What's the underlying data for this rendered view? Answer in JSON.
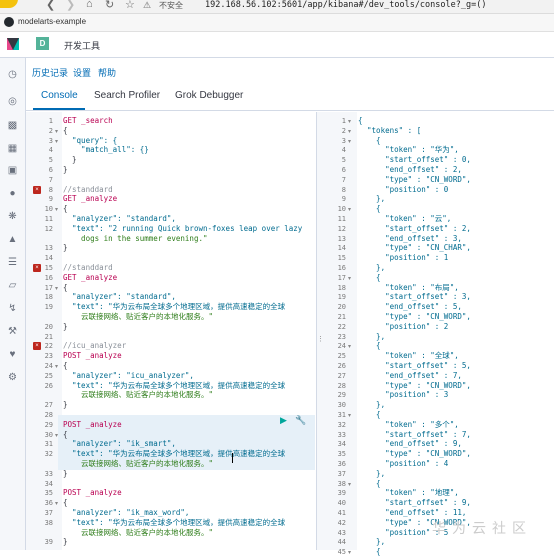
{
  "browser": {
    "security_label": "不安全",
    "url": "192.168.56.102:5601/app/kibana#/dev_tools/console?_g=()",
    "bookmark": "modelarts-example"
  },
  "kibana": {
    "app_title": "开发工具",
    "menu": [
      "历史记录",
      "设置",
      "帮助"
    ],
    "tabs": [
      "Console",
      "Search Profiler",
      "Grok Debugger"
    ],
    "active_tab": "Console"
  },
  "watermark": "华为云社区",
  "editor": {
    "lines": [
      {
        "n": "1",
        "t": "GET _search",
        "c": "kw"
      },
      {
        "n": "2",
        "t": "{",
        "c": "pun",
        "fold": true
      },
      {
        "n": "3",
        "t": "  \"query\": {",
        "c": "key",
        "fold": true
      },
      {
        "n": "4",
        "t": "    \"match_all\": {}",
        "c": "key"
      },
      {
        "n": "5",
        "t": "  }",
        "c": "pun"
      },
      {
        "n": "6",
        "t": "}",
        "c": "pun"
      },
      {
        "n": "7",
        "t": "",
        "c": "pun"
      },
      {
        "n": "8",
        "t": "//standdard",
        "c": "cmt",
        "err": true
      },
      {
        "n": "9",
        "t": "GET _analyze",
        "c": "kw"
      },
      {
        "n": "10",
        "t": "{",
        "c": "pun",
        "fold": true
      },
      {
        "n": "11",
        "t": "  \"analyzer\": \"standard\",",
        "c": "mix"
      },
      {
        "n": "12",
        "t": "  \"text\": \"2 running Quick brown-foxes leap over lazy",
        "c": "mix"
      },
      {
        "n": "",
        "t": "    dogs in the summer evening.\"",
        "c": "str"
      },
      {
        "n": "13",
        "t": "}",
        "c": "pun"
      },
      {
        "n": "14",
        "t": "",
        "c": "pun"
      },
      {
        "n": "15",
        "t": "//standdard",
        "c": "cmt",
        "err": true
      },
      {
        "n": "16",
        "t": "GET _analyze",
        "c": "kw"
      },
      {
        "n": "17",
        "t": "{",
        "c": "pun",
        "fold": true
      },
      {
        "n": "18",
        "t": "  \"analyzer\": \"standard\",",
        "c": "mix"
      },
      {
        "n": "19",
        "t": "  \"text\": \"华为云布局全球多个地理区域，提供高速稳定的全球",
        "c": "mix"
      },
      {
        "n": "",
        "t": "    云联接网络、贴近客户的本地化服务。\"",
        "c": "str"
      },
      {
        "n": "20",
        "t": "}",
        "c": "pun"
      },
      {
        "n": "21",
        "t": "",
        "c": "pun"
      },
      {
        "n": "22",
        "t": "//icu_analyzer",
        "c": "cmt",
        "err": true
      },
      {
        "n": "23",
        "t": "POST _analyze",
        "c": "kw"
      },
      {
        "n": "24",
        "t": "{",
        "c": "pun",
        "fold": true
      },
      {
        "n": "25",
        "t": "  \"analyzer\": \"icu_analyzer\",",
        "c": "mix"
      },
      {
        "n": "26",
        "t": "  \"text\": \"华为云布局全球多个地理区域，提供高速稳定的全球",
        "c": "mix"
      },
      {
        "n": "",
        "t": "    云联接网络、贴近客户的本地化服务。\"",
        "c": "str"
      },
      {
        "n": "27",
        "t": "}",
        "c": "pun"
      },
      {
        "n": "28",
        "t": "",
        "c": "pun"
      },
      {
        "n": "29",
        "t": "POST _analyze",
        "c": "kw",
        "sel": true
      },
      {
        "n": "30",
        "t": "{",
        "c": "pun",
        "fold": true,
        "sel": true
      },
      {
        "n": "31",
        "t": "  \"analyzer\": \"ik_smart\",",
        "c": "mix",
        "sel": true
      },
      {
        "n": "32",
        "t": "  \"text\": \"华为云布局全球多个地理区域，提供高速稳定的全球",
        "c": "mix",
        "sel": true
      },
      {
        "n": "",
        "t": "    云联接网络、贴近客户的本地化服务。\"",
        "c": "str",
        "sel": true
      },
      {
        "n": "33",
        "t": "}",
        "c": "pun",
        "sel": true
      },
      {
        "n": "34",
        "t": "",
        "c": "pun"
      },
      {
        "n": "35",
        "t": "POST _analyze",
        "c": "kw"
      },
      {
        "n": "36",
        "t": "{",
        "c": "pun",
        "fold": true
      },
      {
        "n": "37",
        "t": "  \"analyzer\": \"ik_max_word\",",
        "c": "mix"
      },
      {
        "n": "38",
        "t": "  \"text\": \"华为云布局全球多个地理区域，提供高速稳定的全球",
        "c": "mix"
      },
      {
        "n": "",
        "t": "    云联接网络、贴近客户的本地化服务。\"",
        "c": "str"
      },
      {
        "n": "39",
        "t": "}",
        "c": "pun"
      }
    ]
  },
  "output": {
    "lines": [
      {
        "n": "1",
        "t": "{",
        "fold": true
      },
      {
        "n": "2",
        "t": "  \"tokens\" : [",
        "fold": true
      },
      {
        "n": "3",
        "t": "    {",
        "fold": true
      },
      {
        "n": "4",
        "t": "      \"token\" : \"华为\","
      },
      {
        "n": "5",
        "t": "      \"start_offset\" : 0,"
      },
      {
        "n": "6",
        "t": "      \"end_offset\" : 2,"
      },
      {
        "n": "7",
        "t": "      \"type\" : \"CN_WORD\","
      },
      {
        "n": "8",
        "t": "      \"position\" : 0"
      },
      {
        "n": "9",
        "t": "    },"
      },
      {
        "n": "10",
        "t": "    {",
        "fold": true
      },
      {
        "n": "11",
        "t": "      \"token\" : \"云\","
      },
      {
        "n": "12",
        "t": "      \"start_offset\" : 2,"
      },
      {
        "n": "13",
        "t": "      \"end_offset\" : 3,"
      },
      {
        "n": "14",
        "t": "      \"type\" : \"CN_CHAR\","
      },
      {
        "n": "15",
        "t": "      \"position\" : 1"
      },
      {
        "n": "16",
        "t": "    },"
      },
      {
        "n": "17",
        "t": "    {",
        "fold": true
      },
      {
        "n": "18",
        "t": "      \"token\" : \"布局\","
      },
      {
        "n": "19",
        "t": "      \"start_offset\" : 3,"
      },
      {
        "n": "20",
        "t": "      \"end_offset\" : 5,"
      },
      {
        "n": "21",
        "t": "      \"type\" : \"CN_WORD\","
      },
      {
        "n": "22",
        "t": "      \"position\" : 2"
      },
      {
        "n": "23",
        "t": "    },"
      },
      {
        "n": "24",
        "t": "    {",
        "fold": true
      },
      {
        "n": "25",
        "t": "      \"token\" : \"全球\","
      },
      {
        "n": "26",
        "t": "      \"start_offset\" : 5,"
      },
      {
        "n": "27",
        "t": "      \"end_offset\" : 7,"
      },
      {
        "n": "28",
        "t": "      \"type\" : \"CN_WORD\","
      },
      {
        "n": "29",
        "t": "      \"position\" : 3"
      },
      {
        "n": "30",
        "t": "    },"
      },
      {
        "n": "31",
        "t": "    {",
        "fold": true
      },
      {
        "n": "32",
        "t": "      \"token\" : \"多个\","
      },
      {
        "n": "33",
        "t": "      \"start_offset\" : 7,"
      },
      {
        "n": "34",
        "t": "      \"end_offset\" : 9,"
      },
      {
        "n": "35",
        "t": "      \"type\" : \"CN_WORD\","
      },
      {
        "n": "36",
        "t": "      \"position\" : 4"
      },
      {
        "n": "37",
        "t": "    },"
      },
      {
        "n": "38",
        "t": "    {",
        "fold": true
      },
      {
        "n": "39",
        "t": "      \"token\" : \"地理\","
      },
      {
        "n": "40",
        "t": "      \"start_offset\" : 9,"
      },
      {
        "n": "41",
        "t": "      \"end_offset\" : 11,"
      },
      {
        "n": "42",
        "t": "      \"type\" : \"CN_WORD\","
      },
      {
        "n": "43",
        "t": "      \"position\" : 5"
      },
      {
        "n": "44",
        "t": "    },"
      },
      {
        "n": "45",
        "t": "    {",
        "fold": true
      }
    ]
  }
}
